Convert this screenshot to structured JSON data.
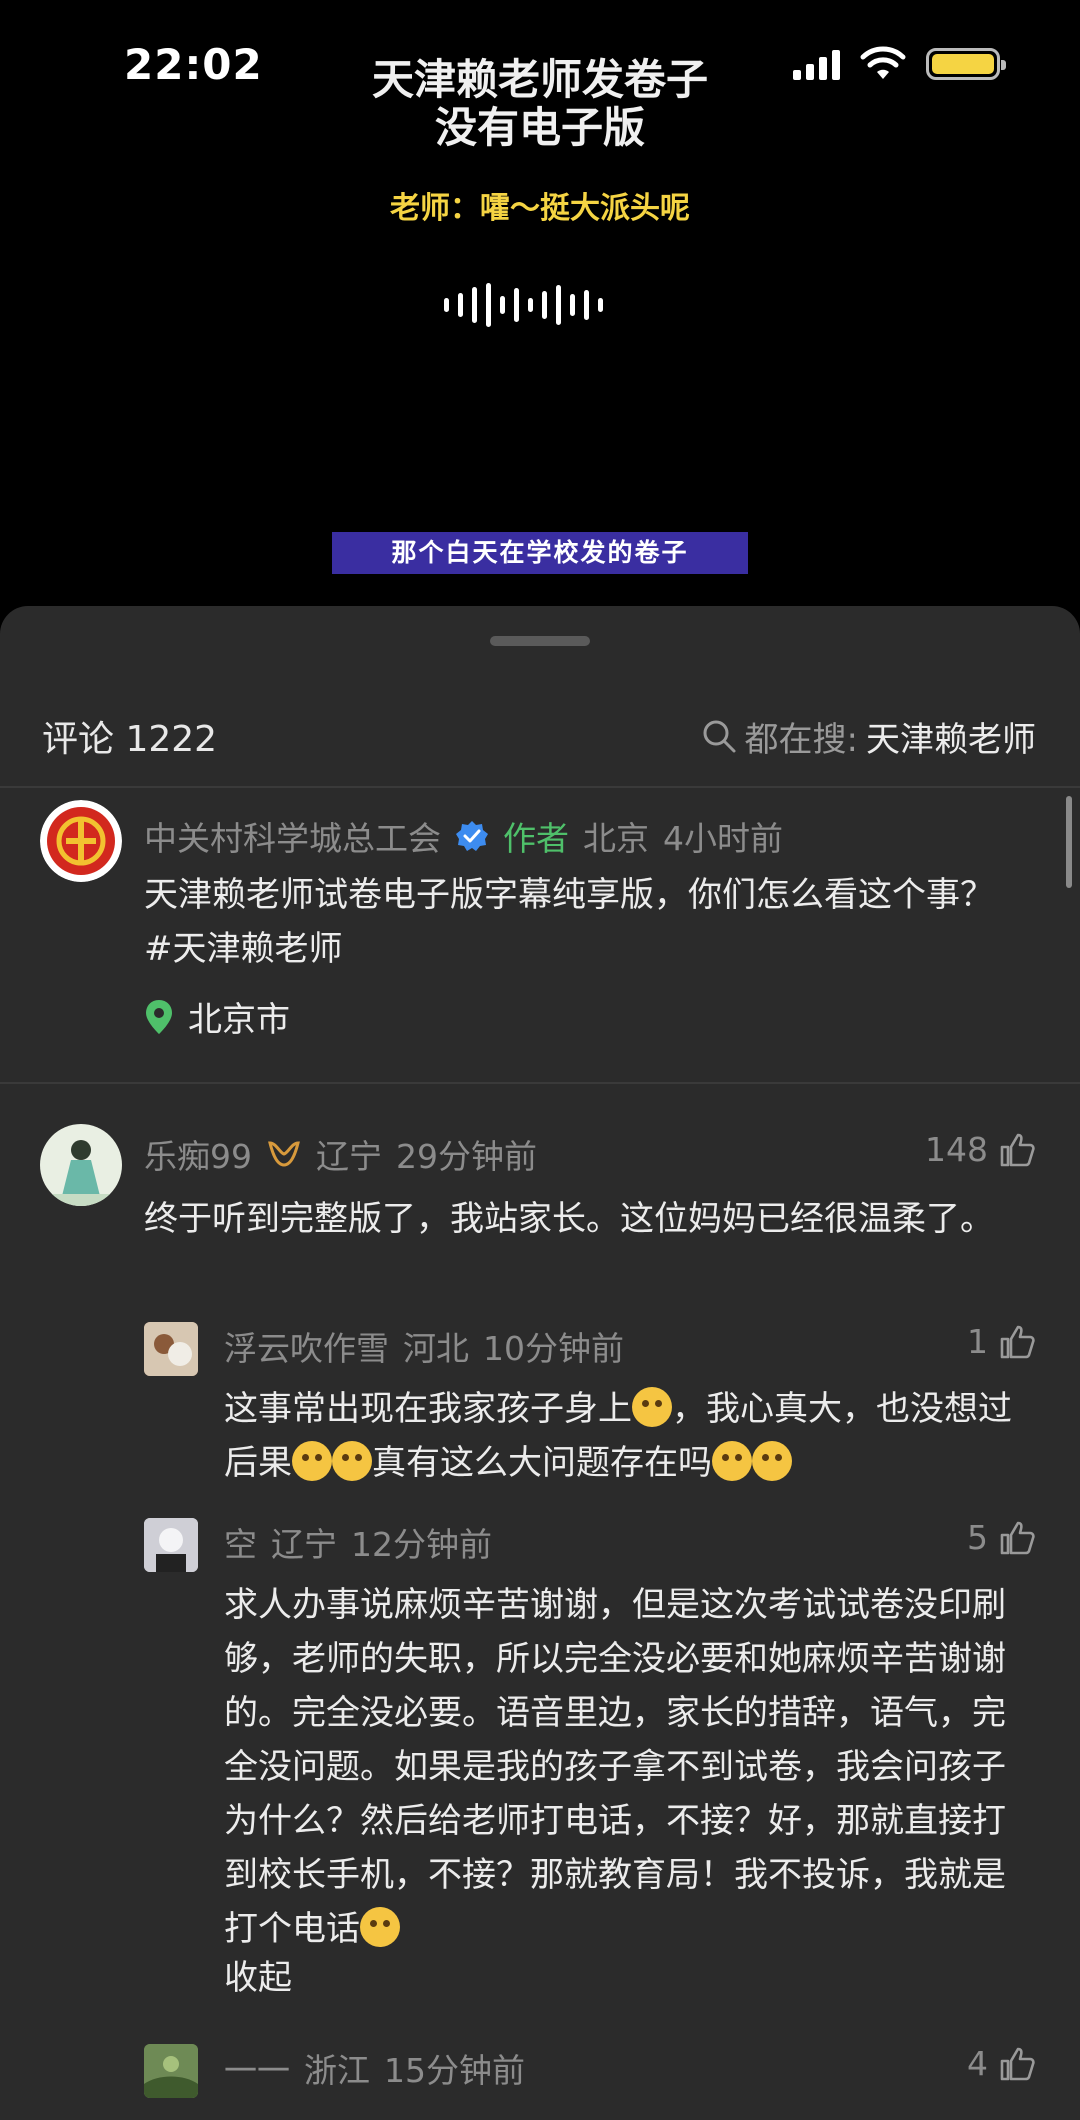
{
  "status": {
    "time": "22:02"
  },
  "video": {
    "title_line1": "天津赖老师发卷子",
    "title_line2": "没有电子版",
    "quote": "老师：嚯～挺大派头呢",
    "subtitle": "那个白天在学校发的卷子"
  },
  "comments_header": {
    "count_label": "评论 1222",
    "search_label": "都在搜:",
    "search_term": "天津赖老师"
  },
  "comments": [
    {
      "name": "中关村科学城总工会",
      "badge": "作者",
      "location": "北京",
      "time": "4小时前",
      "text": "天津赖老师试卷电子版字幕纯享版，你们怎么看这个事？ #天津赖老师",
      "place": "北京市"
    },
    {
      "name": "乐痴99",
      "location": "辽宁",
      "time": "29分钟前",
      "likes": "148",
      "text": "终于听到完整版了，我站家长。这位妈妈已经很温柔了。"
    }
  ],
  "replies": [
    {
      "name": "浮云吹作雪",
      "location": "河北",
      "time": "10分钟前",
      "likes": "1",
      "text_a": "这事常出现在我家孩子身上",
      "text_b": "，我心真大，也没想过后果",
      "text_c": "真有这么大问题存在吗"
    },
    {
      "name": "空",
      "location": "辽宁",
      "time": "12分钟前",
      "likes": "5",
      "text": "求人办事说麻烦辛苦谢谢，但是这次考试试卷没印刷够，老师的失职，所以完全没必要和她麻烦辛苦谢谢的。完全没必要。语音里边，家长的措辞，语气，完全没问题。如果是我的孩子拿不到试卷，我会问孩子为什么？然后给老师打电话，不接？好，那就直接打到校长手机，不接？那就教育局！我不投诉，我就是打个电话",
      "collapse_label": "收起"
    },
    {
      "name": "一一",
      "location": "浙江",
      "time": "15分钟前",
      "likes": "4"
    }
  ],
  "colors": {
    "accent_green": "#4fc06a",
    "quote_yellow": "#f5d443",
    "subtitle_bg": "#3a2ea1",
    "sheet_bg": "#2b2b2b"
  }
}
